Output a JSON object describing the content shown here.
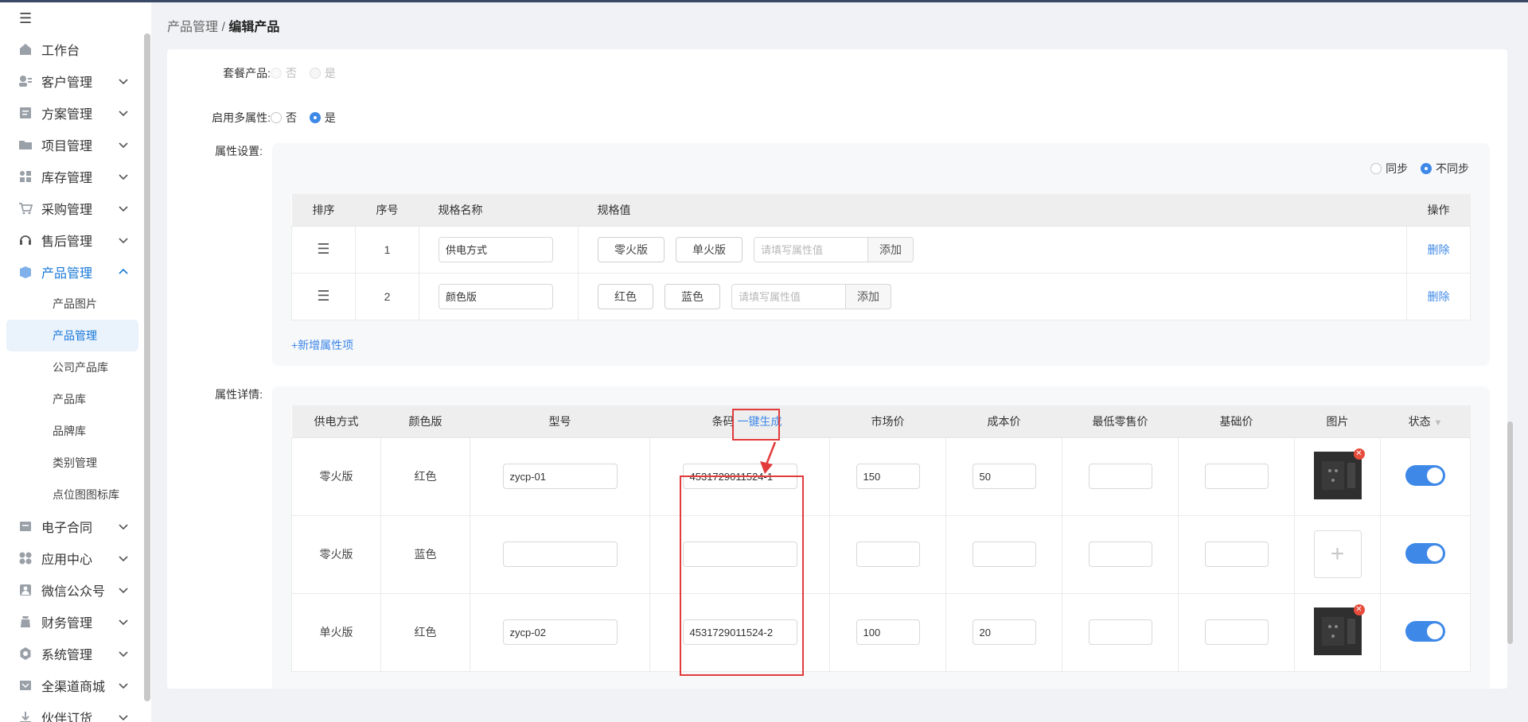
{
  "breadcrumb": {
    "parent": "产品管理",
    "separator": "/",
    "current": "编辑产品"
  },
  "sidebar": {
    "items": [
      {
        "label": "工作台",
        "icon": "home-icon",
        "chevron": false
      },
      {
        "label": "客户管理",
        "icon": "customer-icon",
        "chevron": true
      },
      {
        "label": "方案管理",
        "icon": "plan-icon",
        "chevron": true
      },
      {
        "label": "项目管理",
        "icon": "folder-icon",
        "chevron": true
      },
      {
        "label": "库存管理",
        "icon": "inventory-icon",
        "chevron": true
      },
      {
        "label": "采购管理",
        "icon": "cart-icon",
        "chevron": true
      },
      {
        "label": "售后管理",
        "icon": "headset-icon",
        "chevron": true
      },
      {
        "label": "产品管理",
        "icon": "product-icon",
        "chevron": true,
        "active": true
      }
    ],
    "subitems": [
      "产品图片",
      "产品管理",
      "公司产品库",
      "产品库",
      "品牌库",
      "类别管理",
      "点位图图标库"
    ],
    "active_sub": 1,
    "items_after": [
      {
        "label": "电子合同",
        "icon": "contract-icon"
      },
      {
        "label": "应用中心",
        "icon": "apps-icon"
      },
      {
        "label": "微信公众号",
        "icon": "wechat-icon"
      },
      {
        "label": "财务管理",
        "icon": "finance-icon"
      },
      {
        "label": "系统管理",
        "icon": "system-icon"
      },
      {
        "label": "全渠道商城",
        "icon": "mall-icon"
      },
      {
        "label": "伙伴订货",
        "icon": "partner-icon"
      }
    ]
  },
  "form": {
    "package_label": "套餐产品:",
    "package_no": "否",
    "package_yes": "是",
    "multi_label": "启用多属性:",
    "multi_no": "否",
    "multi_yes": "是",
    "attr_settings_label": "属性设置:",
    "attr_details_label": "属性详情:",
    "sync": "同步",
    "nosync": "不同步",
    "add_attr": "+新增属性项"
  },
  "spec_table": {
    "headers": [
      "排序",
      "序号",
      "规格名称",
      "规格值",
      "操作"
    ],
    "rows": [
      {
        "index": "1",
        "name": "供电方式",
        "values": [
          "零火版",
          "单火版"
        ],
        "placeholder": "请填写属性值",
        "add": "添加",
        "delete": "删除"
      },
      {
        "index": "2",
        "name": "颜色版",
        "values": [
          "红色",
          "蓝色"
        ],
        "placeholder": "请填写属性值",
        "add": "添加",
        "delete": "删除"
      }
    ]
  },
  "detail_table": {
    "headers": [
      "供电方式",
      "颜色版",
      "型号",
      "条码",
      "市场价",
      "成本价",
      "最低零售价",
      "基础价",
      "图片",
      "状态"
    ],
    "generate_label": "一键生成",
    "rows": [
      {
        "power": "零火版",
        "color": "红色",
        "model": "zycp-01",
        "barcode": "4531729011524-1",
        "market": "150",
        "cost": "50",
        "min": "",
        "base": "",
        "image": "socket-image",
        "status": true
      },
      {
        "power": "零火版",
        "color": "蓝色",
        "model": "",
        "barcode": "",
        "market": "",
        "cost": "",
        "min": "",
        "base": "",
        "image": "upload",
        "status": true
      },
      {
        "power": "单火版",
        "color": "红色",
        "model": "zycp-02",
        "barcode": "4531729011524-2",
        "market": "100",
        "cost": "20",
        "min": "",
        "base": "",
        "image": "socket-image",
        "status": true
      }
    ]
  },
  "colors": {
    "accent": "#3e88e8",
    "highlight": "#e23b3b"
  }
}
